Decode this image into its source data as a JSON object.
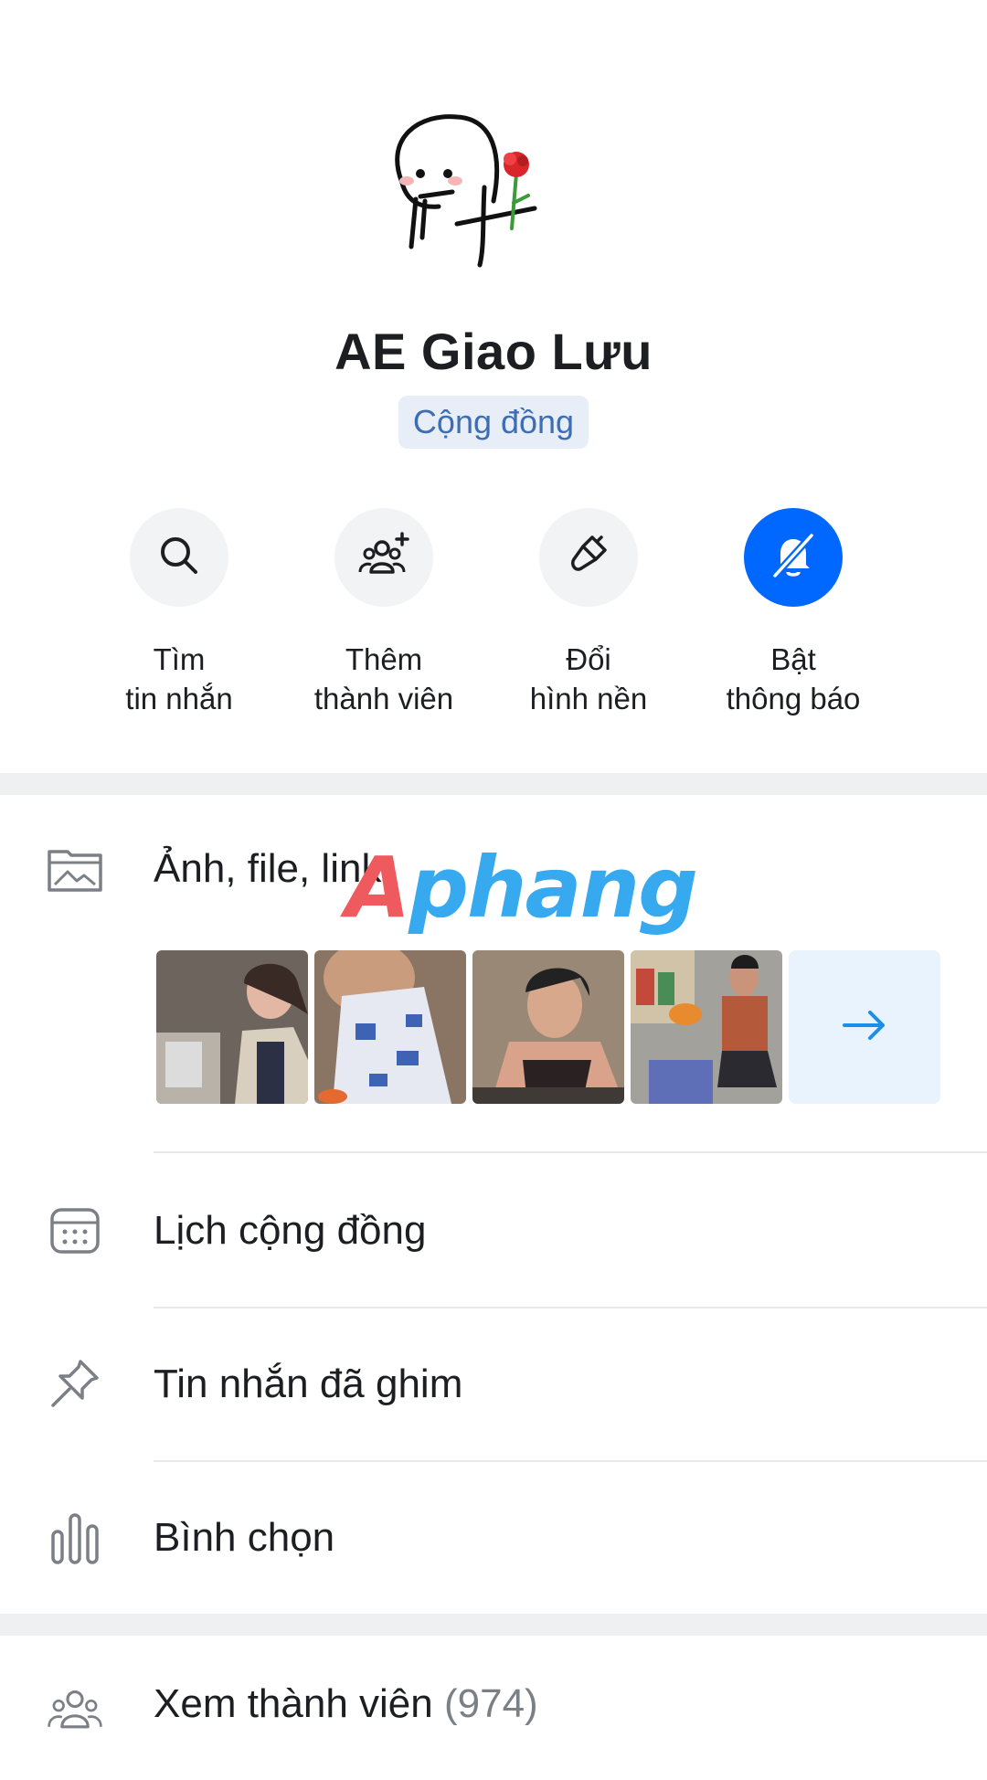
{
  "group": {
    "name": "AE Giao Lưu",
    "type_badge": "Cộng đồng"
  },
  "actions": [
    {
      "label": "Tìm\ntin nhắn",
      "icon": "search-icon"
    },
    {
      "label": "Thêm\nthành viên",
      "icon": "add-members-icon"
    },
    {
      "label": "Đổi\nhình nền",
      "icon": "paint-brush-icon"
    },
    {
      "label": "Bật\nthông báo",
      "icon": "bell-off-icon",
      "active": true
    }
  ],
  "menu": {
    "media_label": "Ảnh, file, link",
    "media_more_icon": "arrow-right-icon",
    "calendar_label": "Lịch cộng đồng",
    "pinned_label": "Tin nhắn đã ghim",
    "poll_label": "Bình chọn",
    "members_label": "Xem thành viên",
    "members_count": "(974)"
  },
  "watermark": {
    "part1": "A",
    "part2": "phang"
  },
  "colors": {
    "accent": "#0068ff",
    "badge_bg": "#e7eef7",
    "badge_text": "#3e6db4",
    "band": "#eff0f2"
  }
}
